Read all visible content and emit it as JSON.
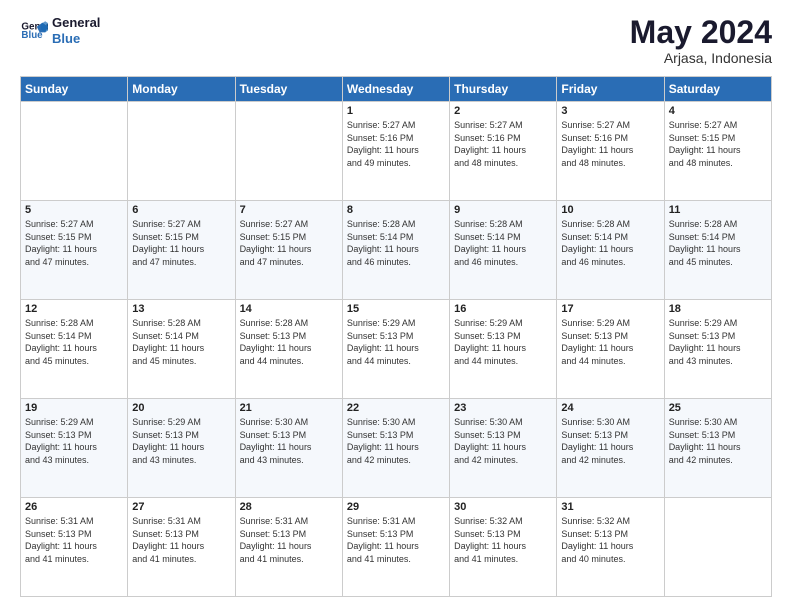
{
  "header": {
    "logo_line1": "General",
    "logo_line2": "Blue",
    "month": "May 2024",
    "location": "Arjasa, Indonesia"
  },
  "weekdays": [
    "Sunday",
    "Monday",
    "Tuesday",
    "Wednesday",
    "Thursday",
    "Friday",
    "Saturday"
  ],
  "weeks": [
    [
      {
        "day": "",
        "info": ""
      },
      {
        "day": "",
        "info": ""
      },
      {
        "day": "",
        "info": ""
      },
      {
        "day": "1",
        "info": "Sunrise: 5:27 AM\nSunset: 5:16 PM\nDaylight: 11 hours\nand 49 minutes."
      },
      {
        "day": "2",
        "info": "Sunrise: 5:27 AM\nSunset: 5:16 PM\nDaylight: 11 hours\nand 48 minutes."
      },
      {
        "day": "3",
        "info": "Sunrise: 5:27 AM\nSunset: 5:16 PM\nDaylight: 11 hours\nand 48 minutes."
      },
      {
        "day": "4",
        "info": "Sunrise: 5:27 AM\nSunset: 5:15 PM\nDaylight: 11 hours\nand 48 minutes."
      }
    ],
    [
      {
        "day": "5",
        "info": "Sunrise: 5:27 AM\nSunset: 5:15 PM\nDaylight: 11 hours\nand 47 minutes."
      },
      {
        "day": "6",
        "info": "Sunrise: 5:27 AM\nSunset: 5:15 PM\nDaylight: 11 hours\nand 47 minutes."
      },
      {
        "day": "7",
        "info": "Sunrise: 5:27 AM\nSunset: 5:15 PM\nDaylight: 11 hours\nand 47 minutes."
      },
      {
        "day": "8",
        "info": "Sunrise: 5:28 AM\nSunset: 5:14 PM\nDaylight: 11 hours\nand 46 minutes."
      },
      {
        "day": "9",
        "info": "Sunrise: 5:28 AM\nSunset: 5:14 PM\nDaylight: 11 hours\nand 46 minutes."
      },
      {
        "day": "10",
        "info": "Sunrise: 5:28 AM\nSunset: 5:14 PM\nDaylight: 11 hours\nand 46 minutes."
      },
      {
        "day": "11",
        "info": "Sunrise: 5:28 AM\nSunset: 5:14 PM\nDaylight: 11 hours\nand 45 minutes."
      }
    ],
    [
      {
        "day": "12",
        "info": "Sunrise: 5:28 AM\nSunset: 5:14 PM\nDaylight: 11 hours\nand 45 minutes."
      },
      {
        "day": "13",
        "info": "Sunrise: 5:28 AM\nSunset: 5:14 PM\nDaylight: 11 hours\nand 45 minutes."
      },
      {
        "day": "14",
        "info": "Sunrise: 5:28 AM\nSunset: 5:13 PM\nDaylight: 11 hours\nand 44 minutes."
      },
      {
        "day": "15",
        "info": "Sunrise: 5:29 AM\nSunset: 5:13 PM\nDaylight: 11 hours\nand 44 minutes."
      },
      {
        "day": "16",
        "info": "Sunrise: 5:29 AM\nSunset: 5:13 PM\nDaylight: 11 hours\nand 44 minutes."
      },
      {
        "day": "17",
        "info": "Sunrise: 5:29 AM\nSunset: 5:13 PM\nDaylight: 11 hours\nand 44 minutes."
      },
      {
        "day": "18",
        "info": "Sunrise: 5:29 AM\nSunset: 5:13 PM\nDaylight: 11 hours\nand 43 minutes."
      }
    ],
    [
      {
        "day": "19",
        "info": "Sunrise: 5:29 AM\nSunset: 5:13 PM\nDaylight: 11 hours\nand 43 minutes."
      },
      {
        "day": "20",
        "info": "Sunrise: 5:29 AM\nSunset: 5:13 PM\nDaylight: 11 hours\nand 43 minutes."
      },
      {
        "day": "21",
        "info": "Sunrise: 5:30 AM\nSunset: 5:13 PM\nDaylight: 11 hours\nand 43 minutes."
      },
      {
        "day": "22",
        "info": "Sunrise: 5:30 AM\nSunset: 5:13 PM\nDaylight: 11 hours\nand 42 minutes."
      },
      {
        "day": "23",
        "info": "Sunrise: 5:30 AM\nSunset: 5:13 PM\nDaylight: 11 hours\nand 42 minutes."
      },
      {
        "day": "24",
        "info": "Sunrise: 5:30 AM\nSunset: 5:13 PM\nDaylight: 11 hours\nand 42 minutes."
      },
      {
        "day": "25",
        "info": "Sunrise: 5:30 AM\nSunset: 5:13 PM\nDaylight: 11 hours\nand 42 minutes."
      }
    ],
    [
      {
        "day": "26",
        "info": "Sunrise: 5:31 AM\nSunset: 5:13 PM\nDaylight: 11 hours\nand 41 minutes."
      },
      {
        "day": "27",
        "info": "Sunrise: 5:31 AM\nSunset: 5:13 PM\nDaylight: 11 hours\nand 41 minutes."
      },
      {
        "day": "28",
        "info": "Sunrise: 5:31 AM\nSunset: 5:13 PM\nDaylight: 11 hours\nand 41 minutes."
      },
      {
        "day": "29",
        "info": "Sunrise: 5:31 AM\nSunset: 5:13 PM\nDaylight: 11 hours\nand 41 minutes."
      },
      {
        "day": "30",
        "info": "Sunrise: 5:32 AM\nSunset: 5:13 PM\nDaylight: 11 hours\nand 41 minutes."
      },
      {
        "day": "31",
        "info": "Sunrise: 5:32 AM\nSunset: 5:13 PM\nDaylight: 11 hours\nand 40 minutes."
      },
      {
        "day": "",
        "info": ""
      }
    ]
  ]
}
